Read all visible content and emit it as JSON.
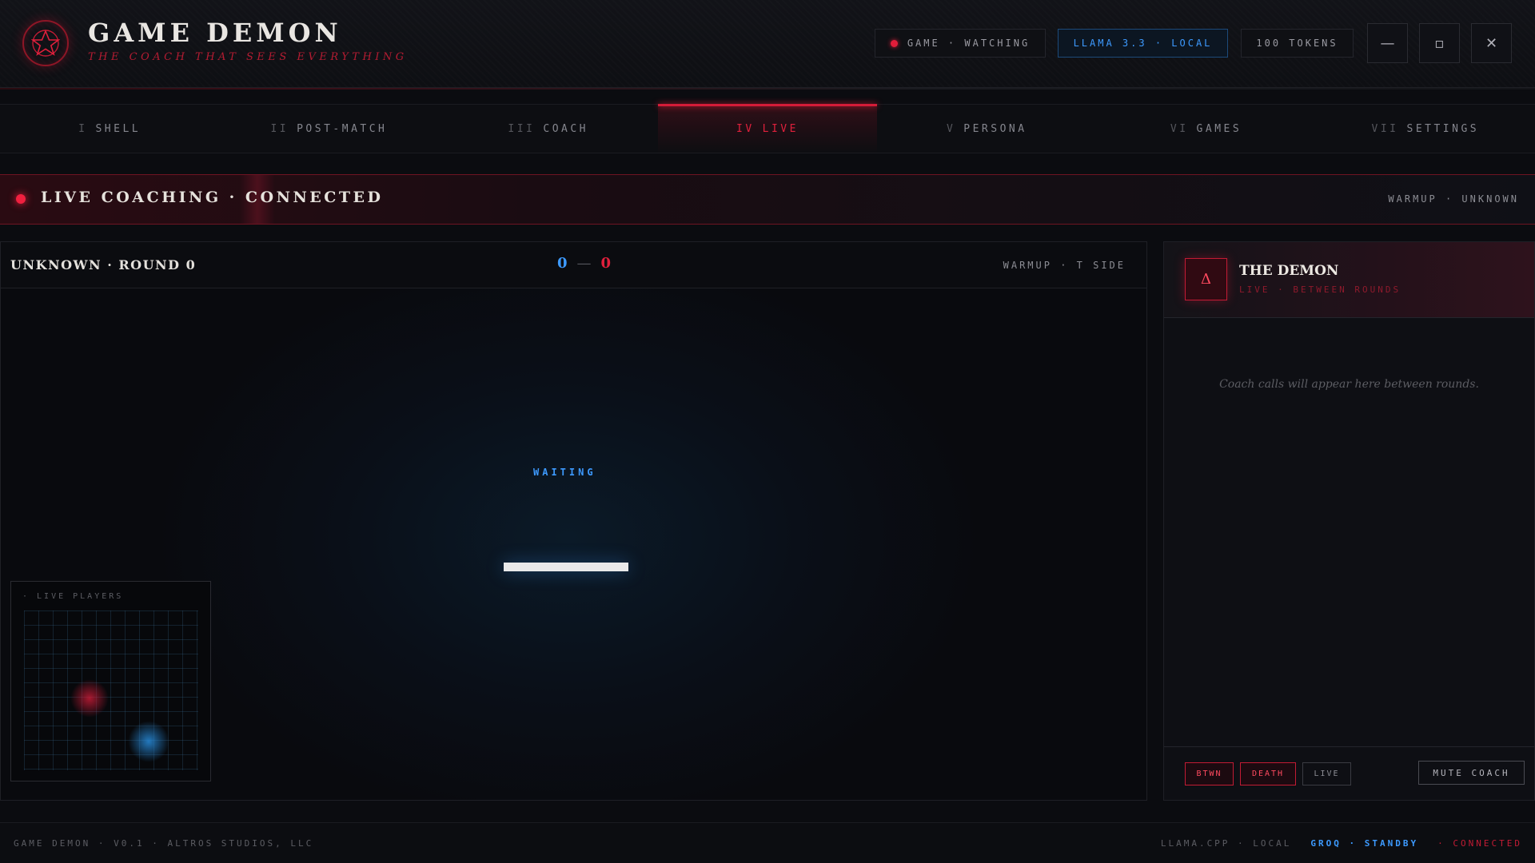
{
  "app": {
    "title": "GAME DEMON",
    "subtitle": "THE COACH THAT SEES EVERYTHING"
  },
  "header": {
    "game_status": "GAME · WATCHING",
    "model": "LLAMA 3.3 · LOCAL",
    "tokens": "100 TOKENS",
    "minimize": "—",
    "maximize": "▫",
    "close": "✕"
  },
  "tabs": [
    {
      "num": "I",
      "label": "SHELL"
    },
    {
      "num": "II",
      "label": "POST-MATCH"
    },
    {
      "num": "III",
      "label": "COACH"
    },
    {
      "num": "IV",
      "label": "LIVE",
      "active": true
    },
    {
      "num": "V",
      "label": "PERSONA"
    },
    {
      "num": "VI",
      "label": "GAMES"
    },
    {
      "num": "VII",
      "label": "SETTINGS"
    }
  ],
  "banner": {
    "status": "LIVE COACHING · CONNECTED",
    "phase": "WARMUP · UNKNOWN"
  },
  "match": {
    "title": "UNKNOWN · ROUND 0",
    "score_ct": "0",
    "score_sep": "—",
    "score_t": "0",
    "phase_side": "WARMUP · T SIDE",
    "state": "WAITING",
    "progress": 1.0,
    "minimap_label": "· LIVE PLAYERS"
  },
  "coach": {
    "avatar_glyph": "Δ",
    "name": "THE DEMON",
    "subtitle": "LIVE · BETWEEN ROUNDS",
    "empty_text": "Coach calls will appear here between rounds.",
    "chips": [
      {
        "label": "BTWN",
        "active": true
      },
      {
        "label": "DEATH",
        "active": true
      },
      {
        "label": "LIVE",
        "active": false
      }
    ],
    "mute_label": "MUTE COACH"
  },
  "footer": {
    "left": "GAME DEMON · V0.1 · ALTROS STUDIOS, LLC",
    "engine": "LLAMA.CPP · LOCAL",
    "groq": "GROQ · STANDBY",
    "connection": "· CONNECTED"
  },
  "colors": {
    "accent_red": "#e0203c",
    "accent_blue": "#3d9aff",
    "background": "#0b0c10"
  }
}
